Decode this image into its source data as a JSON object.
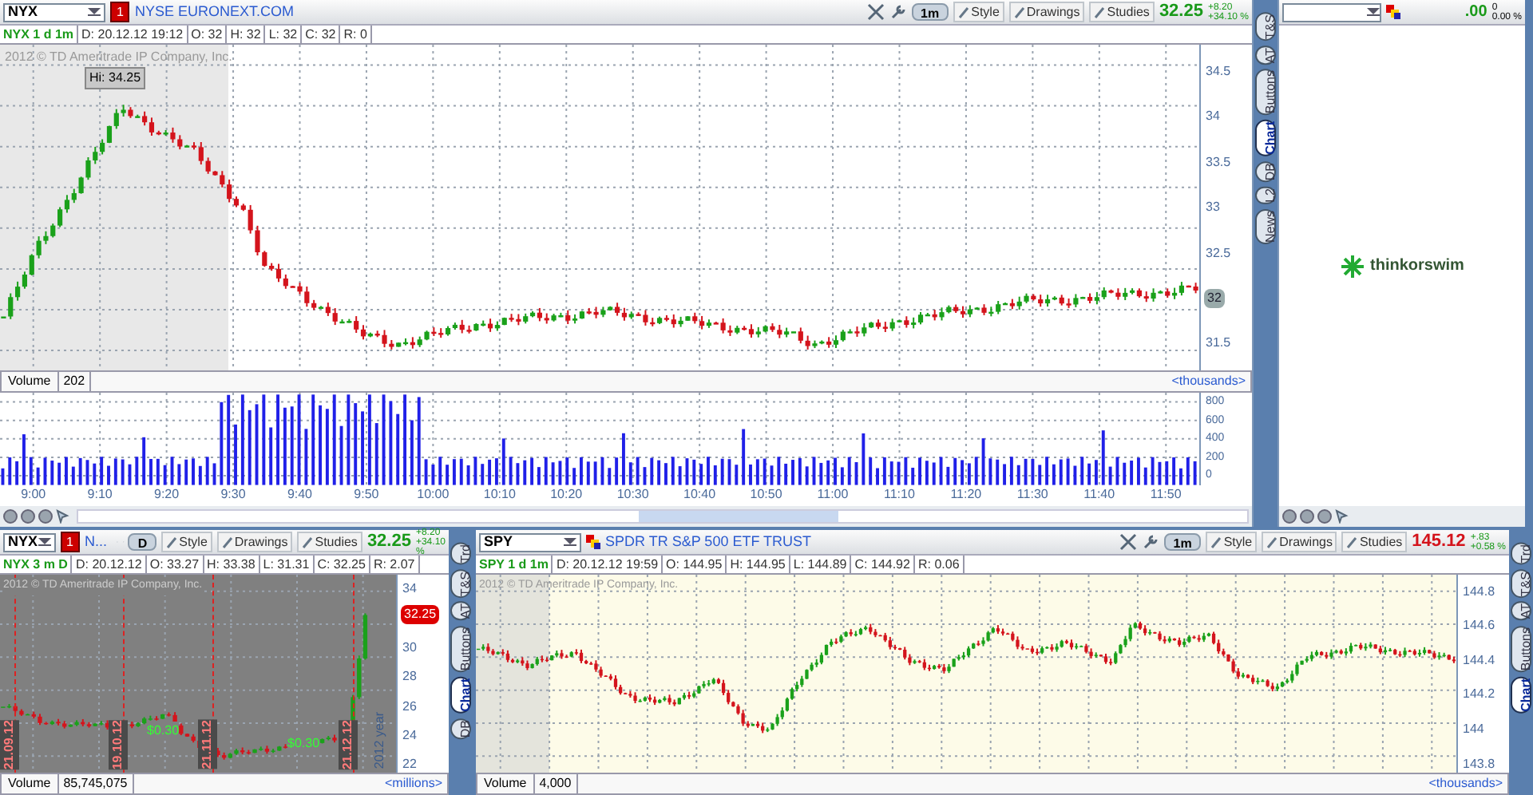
{
  "top_chart": {
    "symbol": "NYX",
    "alert_badge": "1",
    "description": "NYSE EURONEXT.COM",
    "aggregation": "1m",
    "toolbar": [
      "Style",
      "Drawings",
      "Studies"
    ],
    "last": "32.25",
    "change": "+8.20",
    "change_pct": "+34.10 %",
    "info": [
      "NYX 1 d 1m",
      "D: 20.12.12 19:12",
      "O: 32",
      "H: 32",
      "L: 32",
      "C: 32",
      "R: 0"
    ],
    "copyright": "2012 © TD Ameritrade IP Company, Inc.",
    "high_label": "Hi: 34.25",
    "price_ticks": [
      "34.5",
      "34",
      "33.5",
      "33",
      "32.5",
      "31.5"
    ],
    "current_price": "32",
    "volume_label": "Volume",
    "volume_value": "202",
    "volume_units": "<thousands>",
    "volume_ticks": [
      "800",
      "600",
      "400",
      "200",
      "0"
    ],
    "time_ticks": [
      "9:00",
      "9:10",
      "9:20",
      "9:30",
      "9:40",
      "9:50",
      "10:00",
      "10:10",
      "10:20",
      "10:30",
      "10:40",
      "10:50",
      "11:00",
      "11:10",
      "11:20",
      "11:30",
      "11:40",
      "11:50"
    ]
  },
  "top_side_tabs": [
    {
      "label": "T&S",
      "selected": false
    },
    {
      "label": "AT",
      "selected": false
    },
    {
      "label": "Buttons",
      "selected": false
    },
    {
      "label": "Chart",
      "selected": true
    },
    {
      "label": "DB",
      "selected": false
    },
    {
      "label": "L2",
      "selected": false
    },
    {
      "label": "News",
      "selected": false
    }
  ],
  "right_panel": {
    "last": ".00",
    "change": "0",
    "change_pct": "0.00 %",
    "logo": "thinkorswim"
  },
  "bottom_left_chart": {
    "symbol": "NYX",
    "alert_badge": "1",
    "description": "N...",
    "aggregation": "D",
    "toolbar": [
      "Style",
      "Drawings",
      "Studies"
    ],
    "last": "32.25",
    "change": "+8.20",
    "change_pct": "+34.10 %",
    "info": [
      "NYX 3 m D",
      "D: 20.12.12",
      "O: 33.27",
      "H: 33.38",
      "L: 31.31",
      "C: 32.25",
      "R: 2.07"
    ],
    "copyright": "2012 © TD Ameritrade IP Company, Inc.",
    "price_ticks": [
      "34",
      "30",
      "28",
      "26",
      "24",
      "22"
    ],
    "current_price": "32.25",
    "date_markers": [
      "21.09.12",
      "19.10.12",
      "21.11.12",
      "21.12.12"
    ],
    "year_label": "2012 year",
    "dividends": [
      "$0.30",
      "$0.30"
    ],
    "volume_label": "Volume",
    "volume_value": "85,745,075",
    "volume_units": "<millions>"
  },
  "bottom_left_side_tabs": [
    {
      "label": "Trd",
      "selected": false
    },
    {
      "label": "T&S",
      "selected": false
    },
    {
      "label": "AT",
      "selected": false
    },
    {
      "label": "Buttons",
      "selected": false
    },
    {
      "label": "Chart",
      "selected": true
    },
    {
      "label": "DB",
      "selected": false
    }
  ],
  "bottom_right_chart": {
    "symbol": "SPY",
    "description": "SPDR TR S&P 500 ETF TRUST",
    "aggregation": "1m",
    "toolbar": [
      "Style",
      "Drawings",
      "Studies"
    ],
    "last": "145.12",
    "change": "+.83",
    "change_pct": "+0.58 %",
    "info": [
      "SPY 1 d 1m",
      "D: 20.12.12 19:59",
      "O: 144.95",
      "H: 144.95",
      "L: 144.89",
      "C: 144.92",
      "R: 0.06"
    ],
    "copyright": "2012 © TD Ameritrade IP Company, Inc.",
    "price_ticks": [
      "144.8",
      "144.6",
      "144.4",
      "144.2",
      "144",
      "143.8"
    ],
    "volume_label": "Volume",
    "volume_value": "4,000",
    "volume_units": "<thousands>"
  },
  "bottom_right_side_tabs": [
    {
      "label": "Trd",
      "selected": false
    },
    {
      "label": "T&S",
      "selected": false
    },
    {
      "label": "AT",
      "selected": false
    },
    {
      "label": "Buttons",
      "selected": false
    },
    {
      "label": "Chart",
      "selected": true
    }
  ]
}
